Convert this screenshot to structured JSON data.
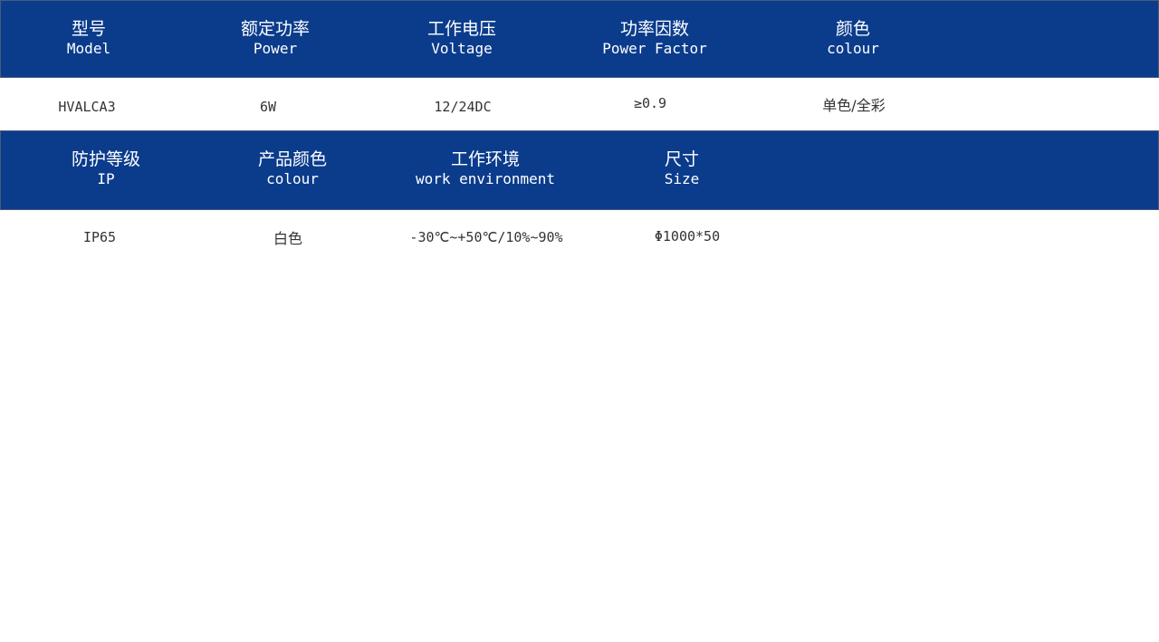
{
  "colors": {
    "header_bg": "#0b3c8c",
    "header_text": "#ffffff",
    "value_text": "#333333"
  },
  "table1": {
    "headers": [
      {
        "zh": "型号",
        "en": "Model"
      },
      {
        "zh": "额定功率",
        "en": "Power"
      },
      {
        "zh": "工作电压",
        "en": "Voltage"
      },
      {
        "zh": "功率因数",
        "en": "Power Factor"
      },
      {
        "zh": "颜色",
        "en": "colour"
      }
    ],
    "values": [
      "HVALCA3",
      "6W",
      "12/24DC",
      "≥0.9",
      "单色/全彩"
    ]
  },
  "table2": {
    "headers": [
      {
        "zh": "防护等级",
        "en": "IP"
      },
      {
        "zh": "产品颜色",
        "en": "colour"
      },
      {
        "zh": "工作环境",
        "en": "work environment"
      },
      {
        "zh": "尺寸",
        "en": "Size"
      }
    ],
    "values": [
      "IP65",
      "白色",
      "-30℃~+50℃/10%~90%",
      "Φ1000*50"
    ]
  }
}
